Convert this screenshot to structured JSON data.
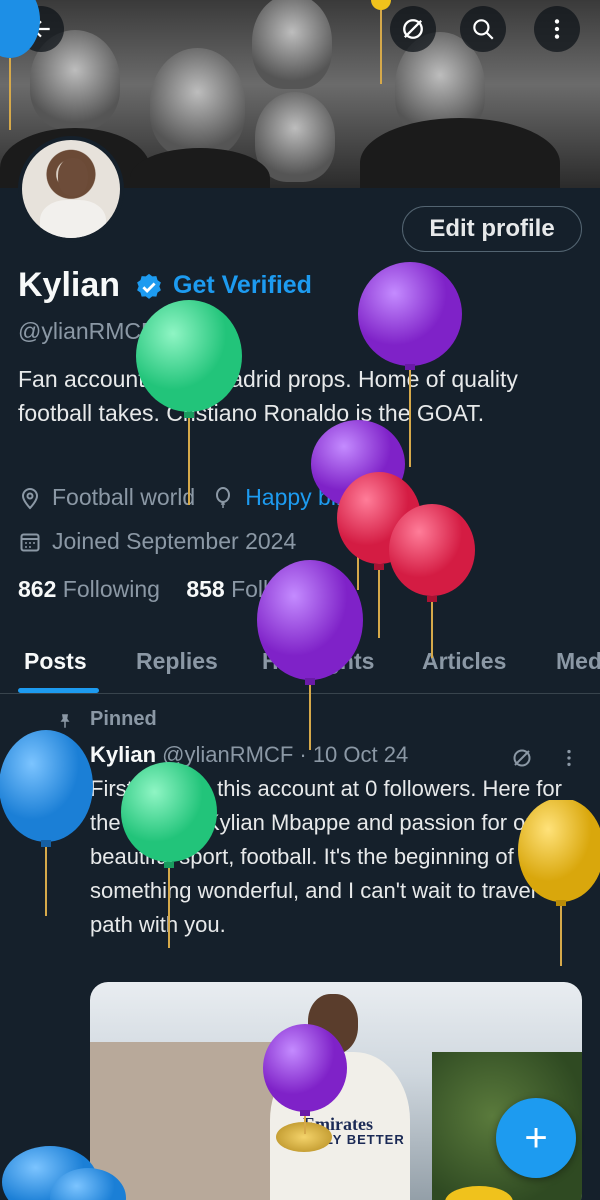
{
  "profile": {
    "name": "Kylian",
    "get_verified": "Get Verified",
    "handle": "@ylianRMCF",
    "bio": "Fan account. Real Madrid props. Home of quality football takes. Cristiano Ronaldo is the GOAT.",
    "location": "Football world",
    "birthday_link": "Happy birthday!",
    "joined": "Joined September 2024",
    "following_count": "862",
    "following_label": "Following",
    "followers_count": "858",
    "followers_label": "Followers",
    "edit_profile_label": "Edit profile"
  },
  "tabs": [
    "Posts",
    "Replies",
    "Highlights",
    "Articles",
    "Media"
  ],
  "active_tab": "Posts",
  "pinned_label": "Pinned",
  "post": {
    "author": "Kylian",
    "handle_date": "@ylianRMCF · 10 Oct 24",
    "text": "First post on this account at 0 followers. Here for the love for Kylian Mbappe and passion for our beautiful sport, football. It's the beginning of something wonderful, and I can't wait to travel this path with you.",
    "image_sponsor": "Emirates",
    "image_sponsor_sub": "FLY BETTER"
  },
  "fab_label": "+",
  "colors": {
    "background": "#15202b",
    "accent": "#1d9bf0",
    "muted_text": "#8b98a5",
    "balloon_purple": "#8e2fd1",
    "balloon_green": "#2ed88a",
    "balloon_red": "#e0284d",
    "balloon_blue": "#1d8fe6",
    "balloon_yellow": "#f0c21c"
  },
  "icons": {
    "back": "back-arrow-icon",
    "grok": "grok-icon",
    "search": "search-icon",
    "more": "more-vertical-icon",
    "verified": "verified-badge-icon",
    "location": "location-pin-icon",
    "birthday": "balloon-icon",
    "calendar": "calendar-icon",
    "pin": "pin-icon",
    "compose": "plus-icon"
  }
}
